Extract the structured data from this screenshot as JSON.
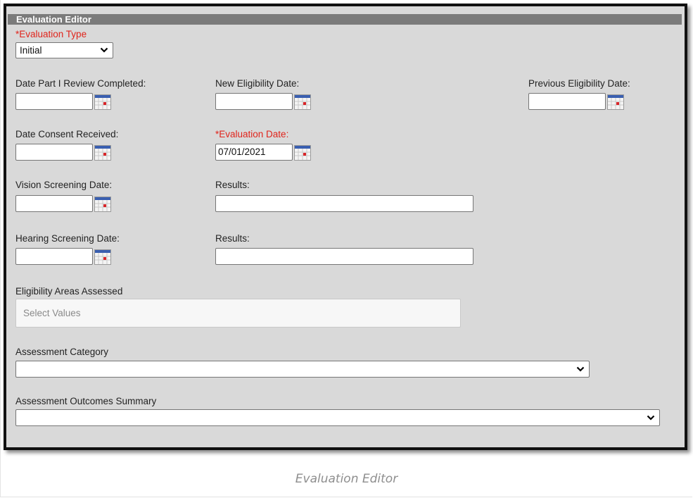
{
  "editor": {
    "title": "Evaluation Editor",
    "caption": "Evaluation Editor"
  },
  "evaluation_type": {
    "label": "*Evaluation Type",
    "value": "Initial"
  },
  "fields": {
    "date_part1_review": {
      "label": "Date Part I Review Completed:",
      "value": ""
    },
    "new_eligibility_date": {
      "label": "New Eligibility Date:",
      "value": ""
    },
    "previous_eligibility_date": {
      "label": "Previous Eligibility Date:",
      "value": ""
    },
    "date_consent_received": {
      "label": "Date Consent Received:",
      "value": ""
    },
    "evaluation_date": {
      "label": "*Evaluation Date:",
      "value": "07/01/2021"
    },
    "vision_screening_date": {
      "label": "Vision Screening Date:",
      "value": ""
    },
    "vision_results": {
      "label": "Results:",
      "value": ""
    },
    "hearing_screening_date": {
      "label": "Hearing Screening Date:",
      "value": ""
    },
    "hearing_results": {
      "label": "Results:",
      "value": ""
    }
  },
  "eligibility_areas": {
    "label": "Eligibility Areas Assessed",
    "placeholder": "Select Values"
  },
  "assessment_category": {
    "label": "Assessment Category",
    "value": ""
  },
  "assessment_outcomes": {
    "label": "Assessment Outcomes Summary",
    "value": ""
  },
  "icons": {
    "calendar": "calendar-icon",
    "dropdown": "chevron-down-icon"
  }
}
